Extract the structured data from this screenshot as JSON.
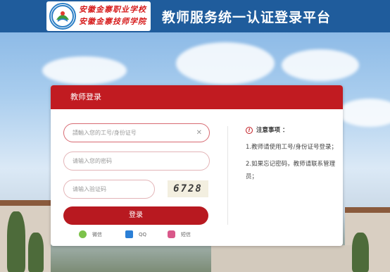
{
  "header": {
    "school_name_line1": "安徽金寨职业学校",
    "school_name_line2": "安徽金寨技师学院",
    "platform_title": "教师服务统一认证登录平台"
  },
  "login": {
    "title": "教师登录",
    "id_placeholder": "請輸入您的工号/身份证号",
    "password_placeholder": "请输入您的密码",
    "captcha_placeholder": "请输入验证码",
    "captcha_code": "6728",
    "submit_label": "登录",
    "clear_symbol": "✕"
  },
  "social_logins": [
    {
      "label": "微信",
      "icon": "wechat-icon",
      "color": "#7cc24a"
    },
    {
      "label": "QQ",
      "icon": "qq-icon",
      "color": "#2b7fd6"
    },
    {
      "label": "短信",
      "icon": "sms-icon",
      "color": "#d9588a"
    }
  ],
  "notice": {
    "title": "注意事项 ：",
    "items": [
      "1.教师请使用工号/身份证号登录；",
      "2.如果忘记密码，教师请联系管理员；"
    ]
  },
  "colors": {
    "header": "#1f5c9c",
    "accent": "#c11b21"
  }
}
